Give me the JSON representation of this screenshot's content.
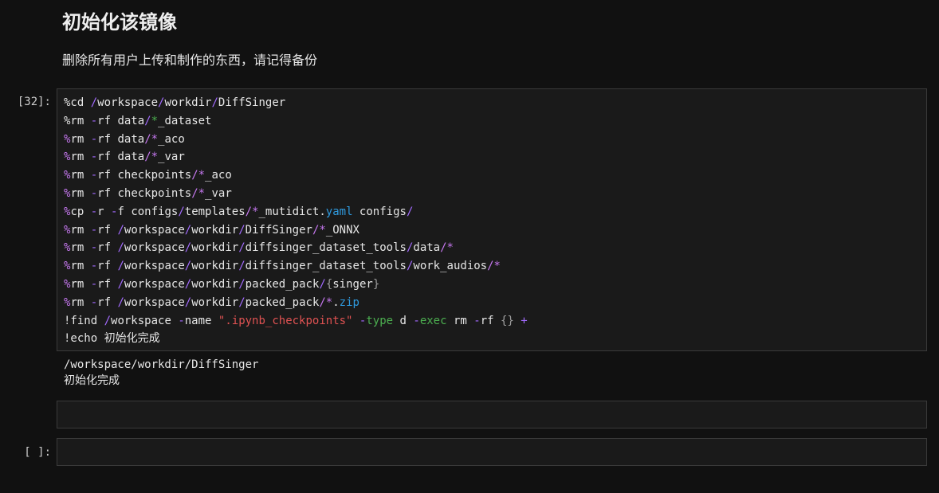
{
  "markdown": {
    "heading": "初始化该镜像",
    "paragraph": "删除所有用户上传和制作的东西，请记得备份"
  },
  "cells": [
    {
      "prompt": "[32]:",
      "lines": [
        [
          {
            "t": "%cd ",
            "c": "plain"
          },
          {
            "t": "/",
            "c": "op"
          },
          {
            "t": "workspace",
            "c": "plain"
          },
          {
            "t": "/",
            "c": "op"
          },
          {
            "t": "workdir",
            "c": "plain"
          },
          {
            "t": "/",
            "c": "op"
          },
          {
            "t": "DiffSinger",
            "c": "plain"
          }
        ],
        [
          {
            "t": "%rm ",
            "c": "plain"
          },
          {
            "t": "-",
            "c": "op"
          },
          {
            "t": "rf data",
            "c": "plain"
          },
          {
            "t": "/",
            "c": "op"
          },
          {
            "t": "*",
            "c": "green"
          },
          {
            "t": "_dataset",
            "c": "plain"
          }
        ],
        [
          {
            "t": "%",
            "c": "magic"
          },
          {
            "t": "rm ",
            "c": "plain"
          },
          {
            "t": "-",
            "c": "op"
          },
          {
            "t": "rf data",
            "c": "plain"
          },
          {
            "t": "/*",
            "c": "glob"
          },
          {
            "t": "_aco",
            "c": "plain"
          }
        ],
        [
          {
            "t": "%",
            "c": "magic"
          },
          {
            "t": "rm ",
            "c": "plain"
          },
          {
            "t": "-",
            "c": "op"
          },
          {
            "t": "rf data",
            "c": "plain"
          },
          {
            "t": "/*",
            "c": "glob"
          },
          {
            "t": "_var",
            "c": "plain"
          }
        ],
        [
          {
            "t": "%",
            "c": "magic"
          },
          {
            "t": "rm ",
            "c": "plain"
          },
          {
            "t": "-",
            "c": "op"
          },
          {
            "t": "rf checkpoints",
            "c": "plain"
          },
          {
            "t": "/*",
            "c": "glob"
          },
          {
            "t": "_aco",
            "c": "plain"
          }
        ],
        [
          {
            "t": "%",
            "c": "magic"
          },
          {
            "t": "rm ",
            "c": "plain"
          },
          {
            "t": "-",
            "c": "op"
          },
          {
            "t": "rf checkpoints",
            "c": "plain"
          },
          {
            "t": "/*",
            "c": "glob"
          },
          {
            "t": "_var",
            "c": "plain"
          }
        ],
        [
          {
            "t": "%",
            "c": "magic"
          },
          {
            "t": "cp ",
            "c": "plain"
          },
          {
            "t": "-",
            "c": "op"
          },
          {
            "t": "r ",
            "c": "plain"
          },
          {
            "t": "-",
            "c": "op"
          },
          {
            "t": "f configs",
            "c": "plain"
          },
          {
            "t": "/",
            "c": "op"
          },
          {
            "t": "templates",
            "c": "plain"
          },
          {
            "t": "/*",
            "c": "glob"
          },
          {
            "t": "_mutidict.",
            "c": "plain"
          },
          {
            "t": "yaml",
            "c": "ext"
          },
          {
            "t": " configs",
            "c": "plain"
          },
          {
            "t": "/",
            "c": "op"
          }
        ],
        [
          {
            "t": "%",
            "c": "magic"
          },
          {
            "t": "rm ",
            "c": "plain"
          },
          {
            "t": "-",
            "c": "op"
          },
          {
            "t": "rf ",
            "c": "plain"
          },
          {
            "t": "/",
            "c": "op"
          },
          {
            "t": "workspace",
            "c": "plain"
          },
          {
            "t": "/",
            "c": "op"
          },
          {
            "t": "workdir",
            "c": "plain"
          },
          {
            "t": "/",
            "c": "op"
          },
          {
            "t": "DiffSinger",
            "c": "plain"
          },
          {
            "t": "/*",
            "c": "glob"
          },
          {
            "t": "_ONNX",
            "c": "plain"
          }
        ],
        [
          {
            "t": "%",
            "c": "magic"
          },
          {
            "t": "rm ",
            "c": "plain"
          },
          {
            "t": "-",
            "c": "op"
          },
          {
            "t": "rf ",
            "c": "plain"
          },
          {
            "t": "/",
            "c": "op"
          },
          {
            "t": "workspace",
            "c": "plain"
          },
          {
            "t": "/",
            "c": "op"
          },
          {
            "t": "workdir",
            "c": "plain"
          },
          {
            "t": "/",
            "c": "op"
          },
          {
            "t": "diffsinger_dataset_tools",
            "c": "plain"
          },
          {
            "t": "/",
            "c": "op"
          },
          {
            "t": "data",
            "c": "plain"
          },
          {
            "t": "/*",
            "c": "glob"
          }
        ],
        [
          {
            "t": "%",
            "c": "magic"
          },
          {
            "t": "rm ",
            "c": "plain"
          },
          {
            "t": "-",
            "c": "op"
          },
          {
            "t": "rf ",
            "c": "plain"
          },
          {
            "t": "/",
            "c": "op"
          },
          {
            "t": "workspace",
            "c": "plain"
          },
          {
            "t": "/",
            "c": "op"
          },
          {
            "t": "workdir",
            "c": "plain"
          },
          {
            "t": "/",
            "c": "op"
          },
          {
            "t": "diffsinger_dataset_tools",
            "c": "plain"
          },
          {
            "t": "/",
            "c": "op"
          },
          {
            "t": "work_audios",
            "c": "plain"
          },
          {
            "t": "/*",
            "c": "glob"
          }
        ],
        [
          {
            "t": "%",
            "c": "magic"
          },
          {
            "t": "rm ",
            "c": "plain"
          },
          {
            "t": "-",
            "c": "op"
          },
          {
            "t": "rf ",
            "c": "plain"
          },
          {
            "t": "/",
            "c": "op"
          },
          {
            "t": "workspace",
            "c": "plain"
          },
          {
            "t": "/",
            "c": "op"
          },
          {
            "t": "workdir",
            "c": "plain"
          },
          {
            "t": "/",
            "c": "op"
          },
          {
            "t": "packed_pack",
            "c": "plain"
          },
          {
            "t": "/",
            "c": "op"
          },
          {
            "t": "{",
            "c": "brace"
          },
          {
            "t": "singer",
            "c": "plain"
          },
          {
            "t": "}",
            "c": "brace"
          }
        ],
        [
          {
            "t": "%",
            "c": "magic"
          },
          {
            "t": "rm ",
            "c": "plain"
          },
          {
            "t": "-",
            "c": "op"
          },
          {
            "t": "rf ",
            "c": "plain"
          },
          {
            "t": "/",
            "c": "op"
          },
          {
            "t": "workspace",
            "c": "plain"
          },
          {
            "t": "/",
            "c": "op"
          },
          {
            "t": "workdir",
            "c": "plain"
          },
          {
            "t": "/",
            "c": "op"
          },
          {
            "t": "packed_pack",
            "c": "plain"
          },
          {
            "t": "/*",
            "c": "glob"
          },
          {
            "t": ".",
            "c": "plain"
          },
          {
            "t": "zip",
            "c": "ext"
          }
        ],
        [
          {
            "t": "!find ",
            "c": "plain"
          },
          {
            "t": "/",
            "c": "op"
          },
          {
            "t": "workspace ",
            "c": "plain"
          },
          {
            "t": "-",
            "c": "op"
          },
          {
            "t": "name ",
            "c": "plain"
          },
          {
            "t": "\".ipynb_checkpoints\"",
            "c": "str"
          },
          {
            "t": " ",
            "c": "plain"
          },
          {
            "t": "-",
            "c": "op"
          },
          {
            "t": "type",
            "c": "green"
          },
          {
            "t": " d ",
            "c": "plain"
          },
          {
            "t": "-",
            "c": "op"
          },
          {
            "t": "exec",
            "c": "green"
          },
          {
            "t": " rm ",
            "c": "plain"
          },
          {
            "t": "-",
            "c": "op"
          },
          {
            "t": "rf ",
            "c": "plain"
          },
          {
            "t": "{}",
            "c": "brace"
          },
          {
            "t": " ",
            "c": "plain"
          },
          {
            "t": "+",
            "c": "op"
          }
        ],
        [
          {
            "t": "!echo 初始化完成",
            "c": "plain"
          }
        ]
      ],
      "output": [
        "/workspace/workdir/DiffSinger",
        "初始化完成"
      ]
    },
    {
      "prompt": "",
      "lines": []
    },
    {
      "prompt": "[ ]:",
      "lines": []
    }
  ]
}
